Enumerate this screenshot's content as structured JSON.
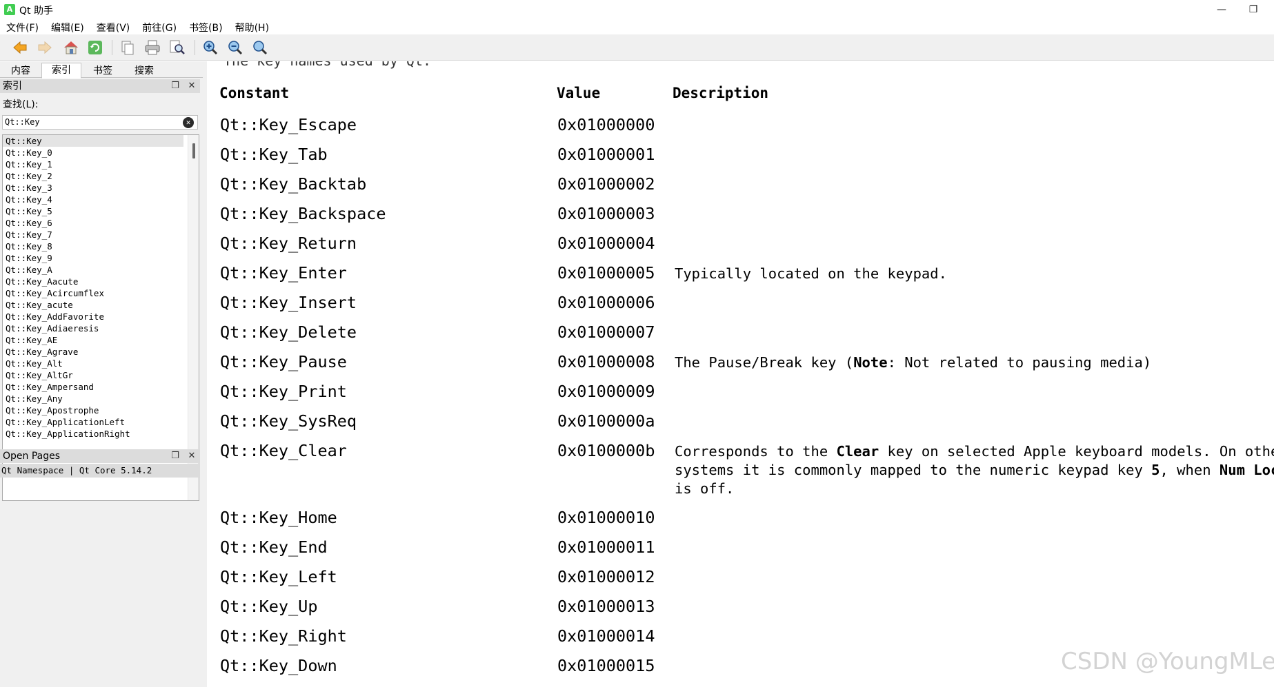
{
  "window": {
    "title": "Qt 助手",
    "icon_letter": "A"
  },
  "menu": [
    "文件(F)",
    "编辑(E)",
    "查看(V)",
    "前往(G)",
    "书签(B)",
    "帮助(H)"
  ],
  "toolbar": {
    "buttons": [
      "back-icon",
      "forward-icon",
      "home-icon",
      "sync-icon",
      "copy-icon",
      "print-icon",
      "find-icon",
      "zoom-in-icon",
      "zoom-out-icon",
      "zoom-reset-icon"
    ]
  },
  "sidebar": {
    "tabs": [
      "内容",
      "索引",
      "书签",
      "搜索"
    ],
    "index_header": "索引",
    "find_label": "查找(L):",
    "search_value": "Qt::Key",
    "index_items": [
      "Qt::Key",
      "Qt::Key_0",
      "Qt::Key_1",
      "Qt::Key_2",
      "Qt::Key_3",
      "Qt::Key_4",
      "Qt::Key_5",
      "Qt::Key_6",
      "Qt::Key_7",
      "Qt::Key_8",
      "Qt::Key_9",
      "Qt::Key_A",
      "Qt::Key_Aacute",
      "Qt::Key_Acircumflex",
      "Qt::Key_acute",
      "Qt::Key_AddFavorite",
      "Qt::Key_Adiaeresis",
      "Qt::Key_AE",
      "Qt::Key_Agrave",
      "Qt::Key_Alt",
      "Qt::Key_AltGr",
      "Qt::Key_Ampersand",
      "Qt::Key_Any",
      "Qt::Key_Apostrophe",
      "Qt::Key_ApplicationLeft",
      "Qt::Key_ApplicationRight"
    ],
    "open_pages_header": "Open Pages",
    "open_pages_item": "Qt Namespace | Qt Core 5.14.2"
  },
  "content": {
    "intro": "The key names used by Qt.",
    "headers": {
      "constant": "Constant",
      "value": "Value",
      "description": "Description"
    },
    "rows": [
      {
        "constant": "Qt::Key_Escape",
        "value": "0x01000000"
      },
      {
        "constant": "Qt::Key_Tab",
        "value": "0x01000001"
      },
      {
        "constant": "Qt::Key_Backtab",
        "value": "0x01000002"
      },
      {
        "constant": "Qt::Key_Backspace",
        "value": "0x01000003"
      },
      {
        "constant": "Qt::Key_Return",
        "value": "0x01000004"
      },
      {
        "constant": "Qt::Key_Enter",
        "value": "0x01000005",
        "desc": "Typically located on the keypad."
      },
      {
        "constant": "Qt::Key_Insert",
        "value": "0x01000006"
      },
      {
        "constant": "Qt::Key_Delete",
        "value": "0x01000007"
      },
      {
        "constant": "Qt::Key_Pause",
        "value": "0x01000008",
        "desc_parts": [
          "The Pause/Break key (",
          "Note",
          ": Not related to pausing media)"
        ]
      },
      {
        "constant": "Qt::Key_Print",
        "value": "0x01000009"
      },
      {
        "constant": "Qt::Key_SysReq",
        "value": "0x0100000a"
      },
      {
        "constant": "Qt::Key_Clear",
        "value": "0x0100000b",
        "desc_lines": [
          [
            "Corresponds to the ",
            "Clear",
            " key on selected Apple keyboard models. On other"
          ],
          [
            "systems it is commonly mapped to the numeric keypad key ",
            "5",
            ", when ",
            "Num Lock"
          ],
          [
            "is off."
          ]
        ]
      },
      {
        "constant": "Qt::Key_Home",
        "value": "0x01000010"
      },
      {
        "constant": "Qt::Key_End",
        "value": "0x01000011"
      },
      {
        "constant": "Qt::Key_Left",
        "value": "0x01000012"
      },
      {
        "constant": "Qt::Key_Up",
        "value": "0x01000013"
      },
      {
        "constant": "Qt::Key_Right",
        "value": "0x01000014"
      },
      {
        "constant": "Qt::Key_Down",
        "value": "0x01000015"
      }
    ]
  },
  "watermark": "CSDN @YoungMLet"
}
